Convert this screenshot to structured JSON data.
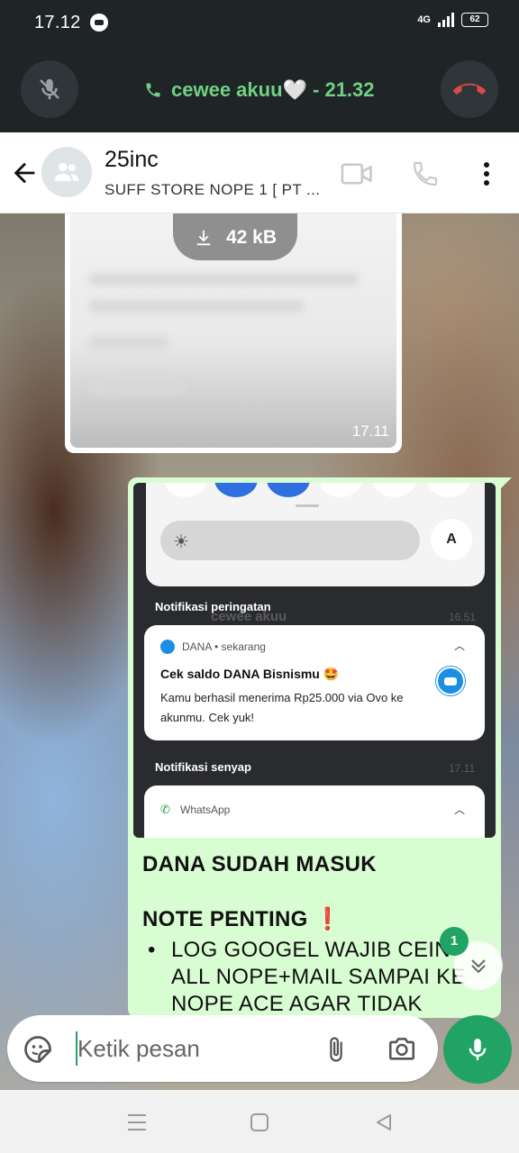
{
  "status_bar": {
    "time": "17.12",
    "network": "4G",
    "battery": "62"
  },
  "call": {
    "label": "cewee akuu🤍 - 21.32",
    "colors": {
      "accent": "#6fd183",
      "end_call": "#e04848",
      "background": "#1f2426"
    }
  },
  "header": {
    "title": "25inc",
    "subtitle": "SUFF STORE NOPE 1 [ PT ...",
    "icons": [
      "back-arrow-icon",
      "group-avatar-icon",
      "video-call-icon",
      "voice-call-icon",
      "more-menu-icon"
    ]
  },
  "image_message": {
    "download_size": "42 kB",
    "time": "17.11"
  },
  "screenshot": {
    "qs_letter": "A",
    "alert_heading": "Notifikasi peringatan",
    "ghost_sender": "cewee akuu",
    "ghost_time_1": "16.51",
    "dana_app": "DANA • sekarang",
    "dana_title": "Cek saldo DANA Bisnismu 🤩",
    "dana_text": "Kamu berhasil menerima Rp25.000 via Ovo ke akunmu. Cek yuk!",
    "silent_heading": "Notifikasi senyap",
    "ghost_time_2": "17.11",
    "whatsapp_app": "WhatsApp"
  },
  "message": {
    "title": "DANA SUDAH MASUK",
    "note": "NOTE PENTING ❗",
    "list_item": "LOG GOOGEL WAJIB CEIN ALL NOPE+MAIL SAMPAI KE NOPE ACE AGAR TIDAK TERJADI"
  },
  "scroll": {
    "unread_badge": "1"
  },
  "composer": {
    "placeholder": "Ketik pesan"
  },
  "colors": {
    "whatsapp_green": "#21a366",
    "bubble_out": "#d9fdd3"
  }
}
